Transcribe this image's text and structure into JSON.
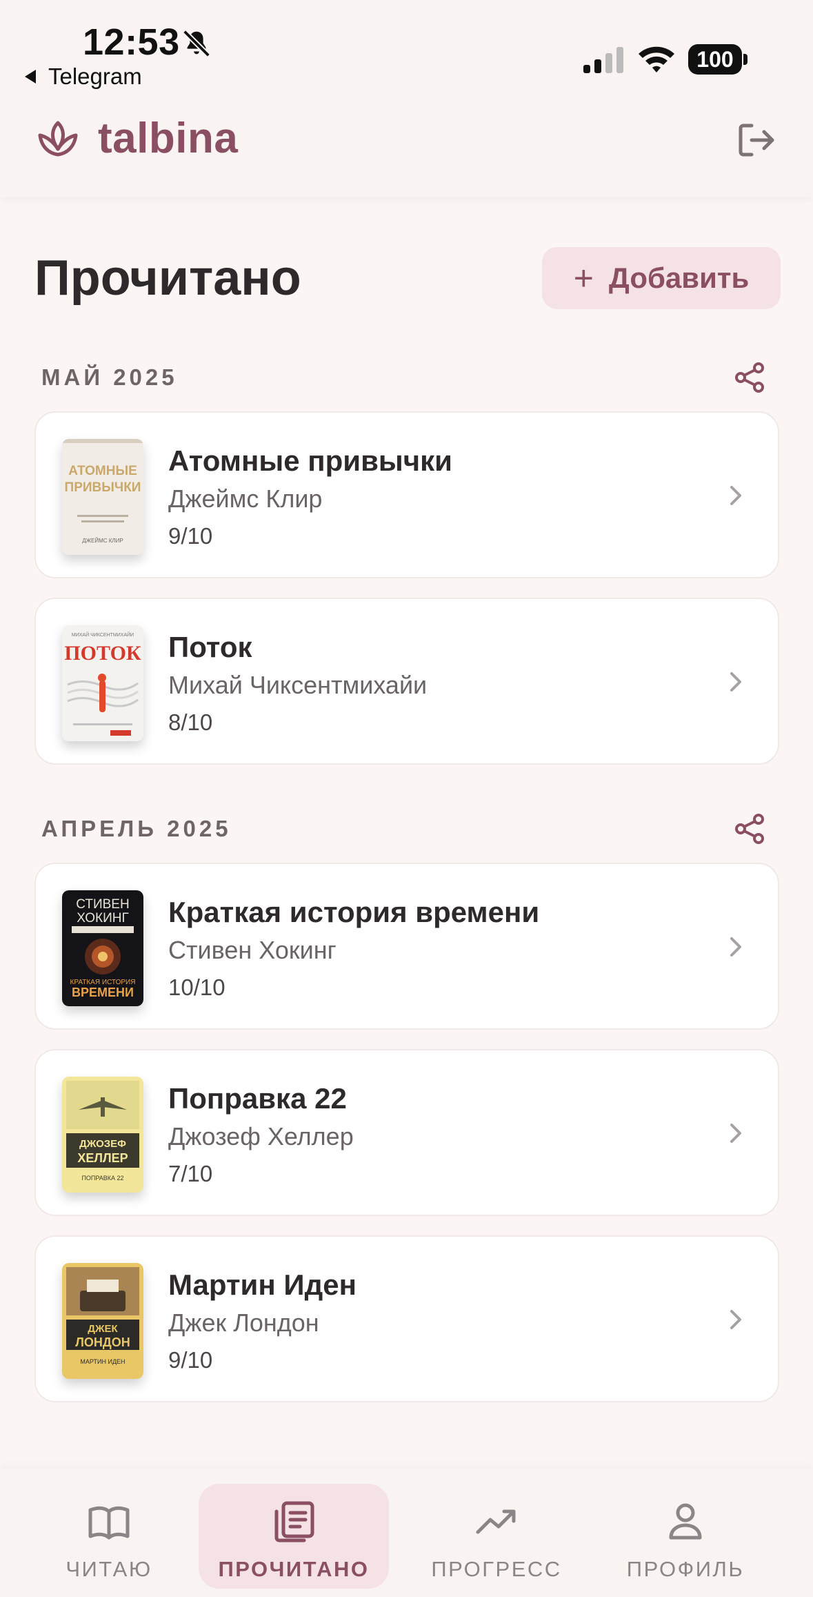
{
  "status_bar": {
    "time": "12:53",
    "back_app": "Telegram",
    "battery": "100",
    "icons": [
      "bell-slash-icon",
      "signal-icon",
      "wifi-icon",
      "battery-icon"
    ]
  },
  "header": {
    "logo_text": "talbina",
    "logo_icon": "lotus-icon",
    "logout_icon": "logout-icon",
    "accent_color": "#8a4f62"
  },
  "page": {
    "title": "Прочитано",
    "add_label": "Добавить",
    "add_icon": "plus-icon"
  },
  "sections": [
    {
      "label": "МАЙ 2025",
      "books": [
        {
          "title": "Атомные привычки",
          "author": "Джеймс Клир",
          "rating": "9/10",
          "cover_text": "АТОМНЫЕ ПРИВЫЧКИ",
          "cover_author": "ДЖЕЙМС КЛИР"
        },
        {
          "title": "Поток",
          "author": "Михай Чиксентмихайи",
          "rating": "8/10",
          "cover_text": "ПОТОК",
          "cover_author": "МИХАЙ ЧИКСЕНТМИХАЙИ"
        }
      ]
    },
    {
      "label": "АПРЕЛЬ 2025",
      "books": [
        {
          "title": "Краткая история времени",
          "author": "Стивен Хокинг",
          "rating": "10/10",
          "cover_text": "СТИВЕН ХОКИНГ",
          "cover_author": "КРАТКАЯ ИСТОРИЯ ВРЕМЕНИ"
        },
        {
          "title": "Поправка 22",
          "author": "Джозеф Хеллер",
          "rating": "7/10",
          "cover_text": "ДЖОЗЕФ ХЕЛЛЕР",
          "cover_author": "ПОПРАВКА 22"
        },
        {
          "title": "Мартин Иден",
          "author": "Джек Лондон",
          "rating": "9/10",
          "cover_text": "ДЖЕК ЛОНДОН",
          "cover_author": "МАРТИН ИДЕН"
        }
      ]
    }
  ],
  "bottom_nav": [
    {
      "label": "ЧИТАЮ",
      "icon": "open-book-icon",
      "active": false
    },
    {
      "label": "ПРОЧИТАНО",
      "icon": "book-list-icon",
      "active": true
    },
    {
      "label": "ПРОГРЕСС",
      "icon": "trending-up-icon",
      "active": false
    },
    {
      "label": "ПРОФИЛЬ",
      "icon": "user-icon",
      "active": false
    }
  ]
}
